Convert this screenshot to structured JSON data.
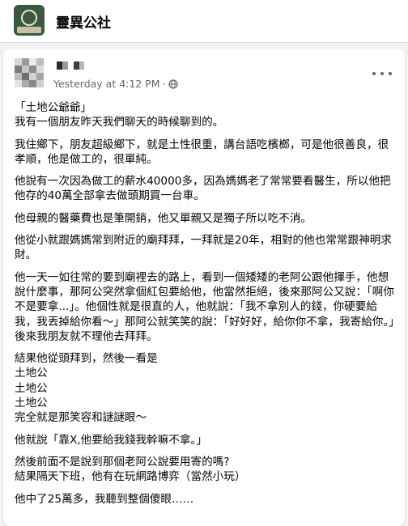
{
  "group": {
    "name": "靈異公社"
  },
  "post": {
    "timestamp": "Yesterday at 4:12 PM",
    "separator": "·",
    "paragraphs": [
      "「土地公爺爺」\n我有一個朋友昨天我們聊天的時候聊到的。",
      "我住鄉下，朋友超級鄉下，就是土性很重，講台語吃檳榔，可是他很善良，很孝順，他是做工的，很單純。",
      "他說有一次因為做工的薪水40000多，因為媽媽老了常常要看醫生，所以他把他存的40萬全部拿去做頭期買一台車。",
      "他母親的醫藥費也是筆開銷，他又單親又是獨子所以吃不消。",
      "他從小就跟媽媽常到附近的廟拜拜，一拜就是20年，相對的他也常常跟神明求財。",
      "他一天一如往常的要到廟裡去的路上，看到一個矮矮的老阿公跟他揮手，他想說什麼事，那阿公突然拿個紅包要給他，他當然拒絕，後來那阿公又說：「啊你不是要拿...」。他個性就是很直的人，他就說：「我不拿別人的錢，你硬要給我，我丟掉給你看～」那阿公就笑笑的說：「好好好，給你你不拿，我寄給你。」後來我朋友就不理他去拜拜。",
      "結果他從頭拜到，然後一看是\n土地公\n土地公\n土地公\n完全就是那笑容和謎謎眼～",
      "他就說「靠X,他要給我錢我幹嘛不拿。」",
      "然後前面不是說到那個老阿公說要用寄的嗎?\n結果隔天下班，他有在玩網路博弈（當然小玩）",
      "他中了25萬多，我聽到整個傻眼……"
    ]
  },
  "icons": {
    "privacy": "globe-icon",
    "more": "more-horizontal-icon"
  },
  "colors": {
    "page_background": "#f0f2f5",
    "card_background": "#ffffff",
    "secondary_text": "#65676b",
    "primary_text": "#050505"
  }
}
